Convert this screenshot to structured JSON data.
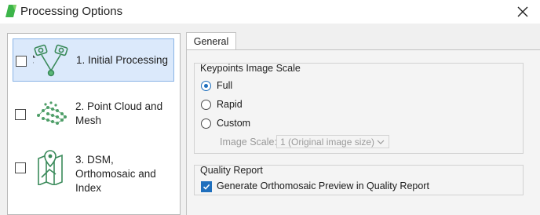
{
  "window": {
    "title": "Processing Options",
    "icons": {
      "app": "pix4d-logo-icon",
      "close": "close-icon"
    }
  },
  "steps": [
    {
      "label": "1. Initial Processing",
      "selected": true,
      "checked": false,
      "icon": "keypoints-tiepoints-icon"
    },
    {
      "label": "2. Point Cloud and Mesh",
      "selected": false,
      "checked": false,
      "icon": "point-cloud-icon"
    },
    {
      "label": "3. DSM, Orthomosaic and Index",
      "selected": false,
      "checked": false,
      "icon": "map-location-icon"
    }
  ],
  "tabs": [
    {
      "label": "General",
      "active": true
    }
  ],
  "keypoints_group": {
    "title": "Keypoints Image Scale",
    "options": [
      {
        "label": "Full",
        "checked": true
      },
      {
        "label": "Rapid",
        "checked": false
      },
      {
        "label": "Custom",
        "checked": false
      }
    ],
    "image_scale_label": "Image Scale:",
    "image_scale_value": "1 (Original image size)"
  },
  "quality_group": {
    "title": "Quality Report",
    "checkbox_label": "Generate Orthomosaic Preview in Quality Report",
    "checkbox_checked": true
  },
  "colors": {
    "accent": "#1f6fbd",
    "selection": "#dbe9fb",
    "icon_green": "#2e8b57"
  }
}
